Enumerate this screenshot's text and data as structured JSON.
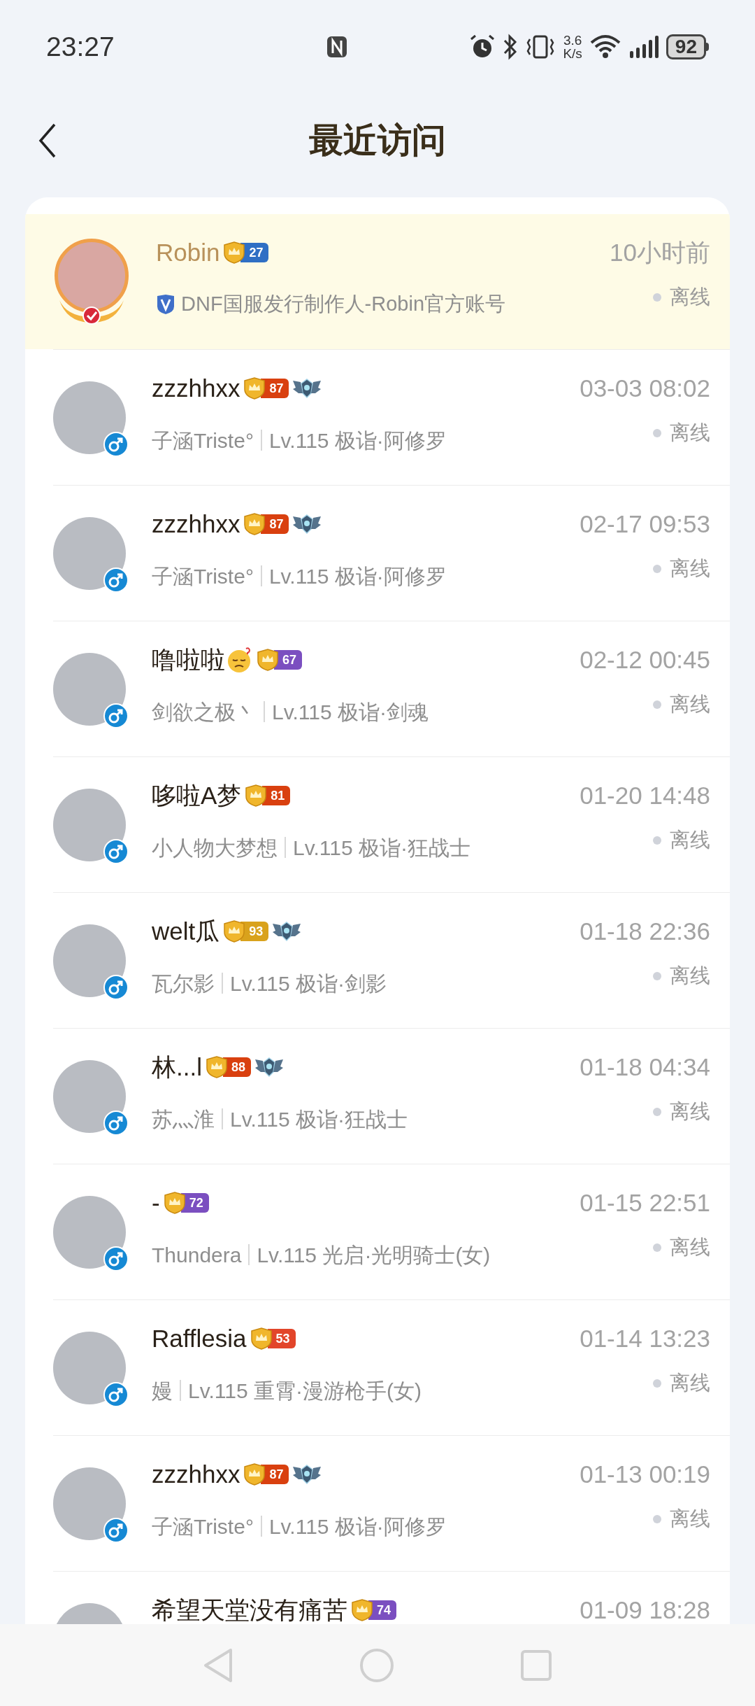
{
  "status_bar": {
    "time": "23:27",
    "speed_value": "3.6",
    "speed_unit": "K/s",
    "battery": "92"
  },
  "header": {
    "title": "最近访问"
  },
  "visitors": [
    {
      "kind": "official",
      "name": "Robin",
      "badge": {
        "level": "27",
        "color": "#2f6fc4"
      },
      "emblem": false,
      "has_emoji": false,
      "subtitle": "DNF国服发行制作人-Robin官方账号",
      "time": "10小时前",
      "status": "离线",
      "highlighted": true
    },
    {
      "kind": "player",
      "name": "zzzhhxx",
      "male": true,
      "badge": {
        "level": "87",
        "color": "#d9400f"
      },
      "emblem": true,
      "has_emoji": false,
      "nickname": "子涵Triste°",
      "role": "Lv.115 极诣·阿修罗",
      "time": "03-03 08:02",
      "status": "离线",
      "highlighted": false
    },
    {
      "kind": "player",
      "name": "zzzhhxx",
      "male": true,
      "badge": {
        "level": "87",
        "color": "#d9400f"
      },
      "emblem": true,
      "has_emoji": false,
      "nickname": "子涵Triste°",
      "role": "Lv.115 极诣·阿修罗",
      "time": "02-17 09:53",
      "status": "离线",
      "highlighted": false
    },
    {
      "kind": "player",
      "name": "噜啦啦",
      "male": true,
      "badge": {
        "level": "67",
        "color": "#7b4fc0"
      },
      "emblem": false,
      "has_emoji": true,
      "nickname": "剑欲之极丶",
      "role": "Lv.115 极诣·剑魂",
      "time": "02-12 00:45",
      "status": "离线",
      "highlighted": false
    },
    {
      "kind": "player",
      "name": "哆啦A梦",
      "male": true,
      "badge": {
        "level": "81",
        "color": "#d9400f"
      },
      "emblem": false,
      "has_emoji": false,
      "nickname": "小人物大梦想",
      "role": "Lv.115 极诣·狂战士",
      "time": "01-20 14:48",
      "status": "离线",
      "highlighted": false
    },
    {
      "kind": "player",
      "name": "welt瓜",
      "male": true,
      "badge": {
        "level": "93",
        "color": "#d9a21c"
      },
      "emblem": true,
      "has_emoji": false,
      "nickname": "瓦尔影",
      "role": "Lv.115 极诣·剑影",
      "time": "01-18 22:36",
      "status": "离线",
      "highlighted": false
    },
    {
      "kind": "player",
      "name": "林...l",
      "male": true,
      "badge": {
        "level": "88",
        "color": "#d9400f"
      },
      "emblem": true,
      "has_emoji": false,
      "nickname": "苏灬淮",
      "role": "Lv.115 极诣·狂战士",
      "time": "01-18 04:34",
      "status": "离线",
      "highlighted": false
    },
    {
      "kind": "player",
      "name": "-",
      "male": true,
      "badge": {
        "level": "72",
        "color": "#7b4fc0"
      },
      "emblem": false,
      "has_emoji": false,
      "nickname": "Thundera",
      "role": "Lv.115 光启·光明骑士(女)",
      "time": "01-15 22:51",
      "status": "离线",
      "highlighted": false
    },
    {
      "kind": "player",
      "name": "Rafflesia",
      "male": true,
      "badge": {
        "level": "53",
        "color": "#e2452a"
      },
      "emblem": false,
      "has_emoji": false,
      "nickname": "嫚",
      "role": "Lv.115 重霄·漫游枪手(女)",
      "time": "01-14 13:23",
      "status": "离线",
      "highlighted": false
    },
    {
      "kind": "player",
      "name": "zzzhhxx",
      "male": true,
      "badge": {
        "level": "87",
        "color": "#d9400f"
      },
      "emblem": true,
      "has_emoji": false,
      "nickname": "子涵Triste°",
      "role": "Lv.115 极诣·阿修罗",
      "time": "01-13 00:19",
      "status": "离线",
      "highlighted": false
    },
    {
      "kind": "player",
      "name": "希望天堂没有痛苦",
      "badge": {
        "level": "74",
        "color": "#7b4fc0"
      },
      "emblem": false,
      "has_emoji": false,
      "time": "01-09 18:28",
      "highlighted": false
    }
  ]
}
